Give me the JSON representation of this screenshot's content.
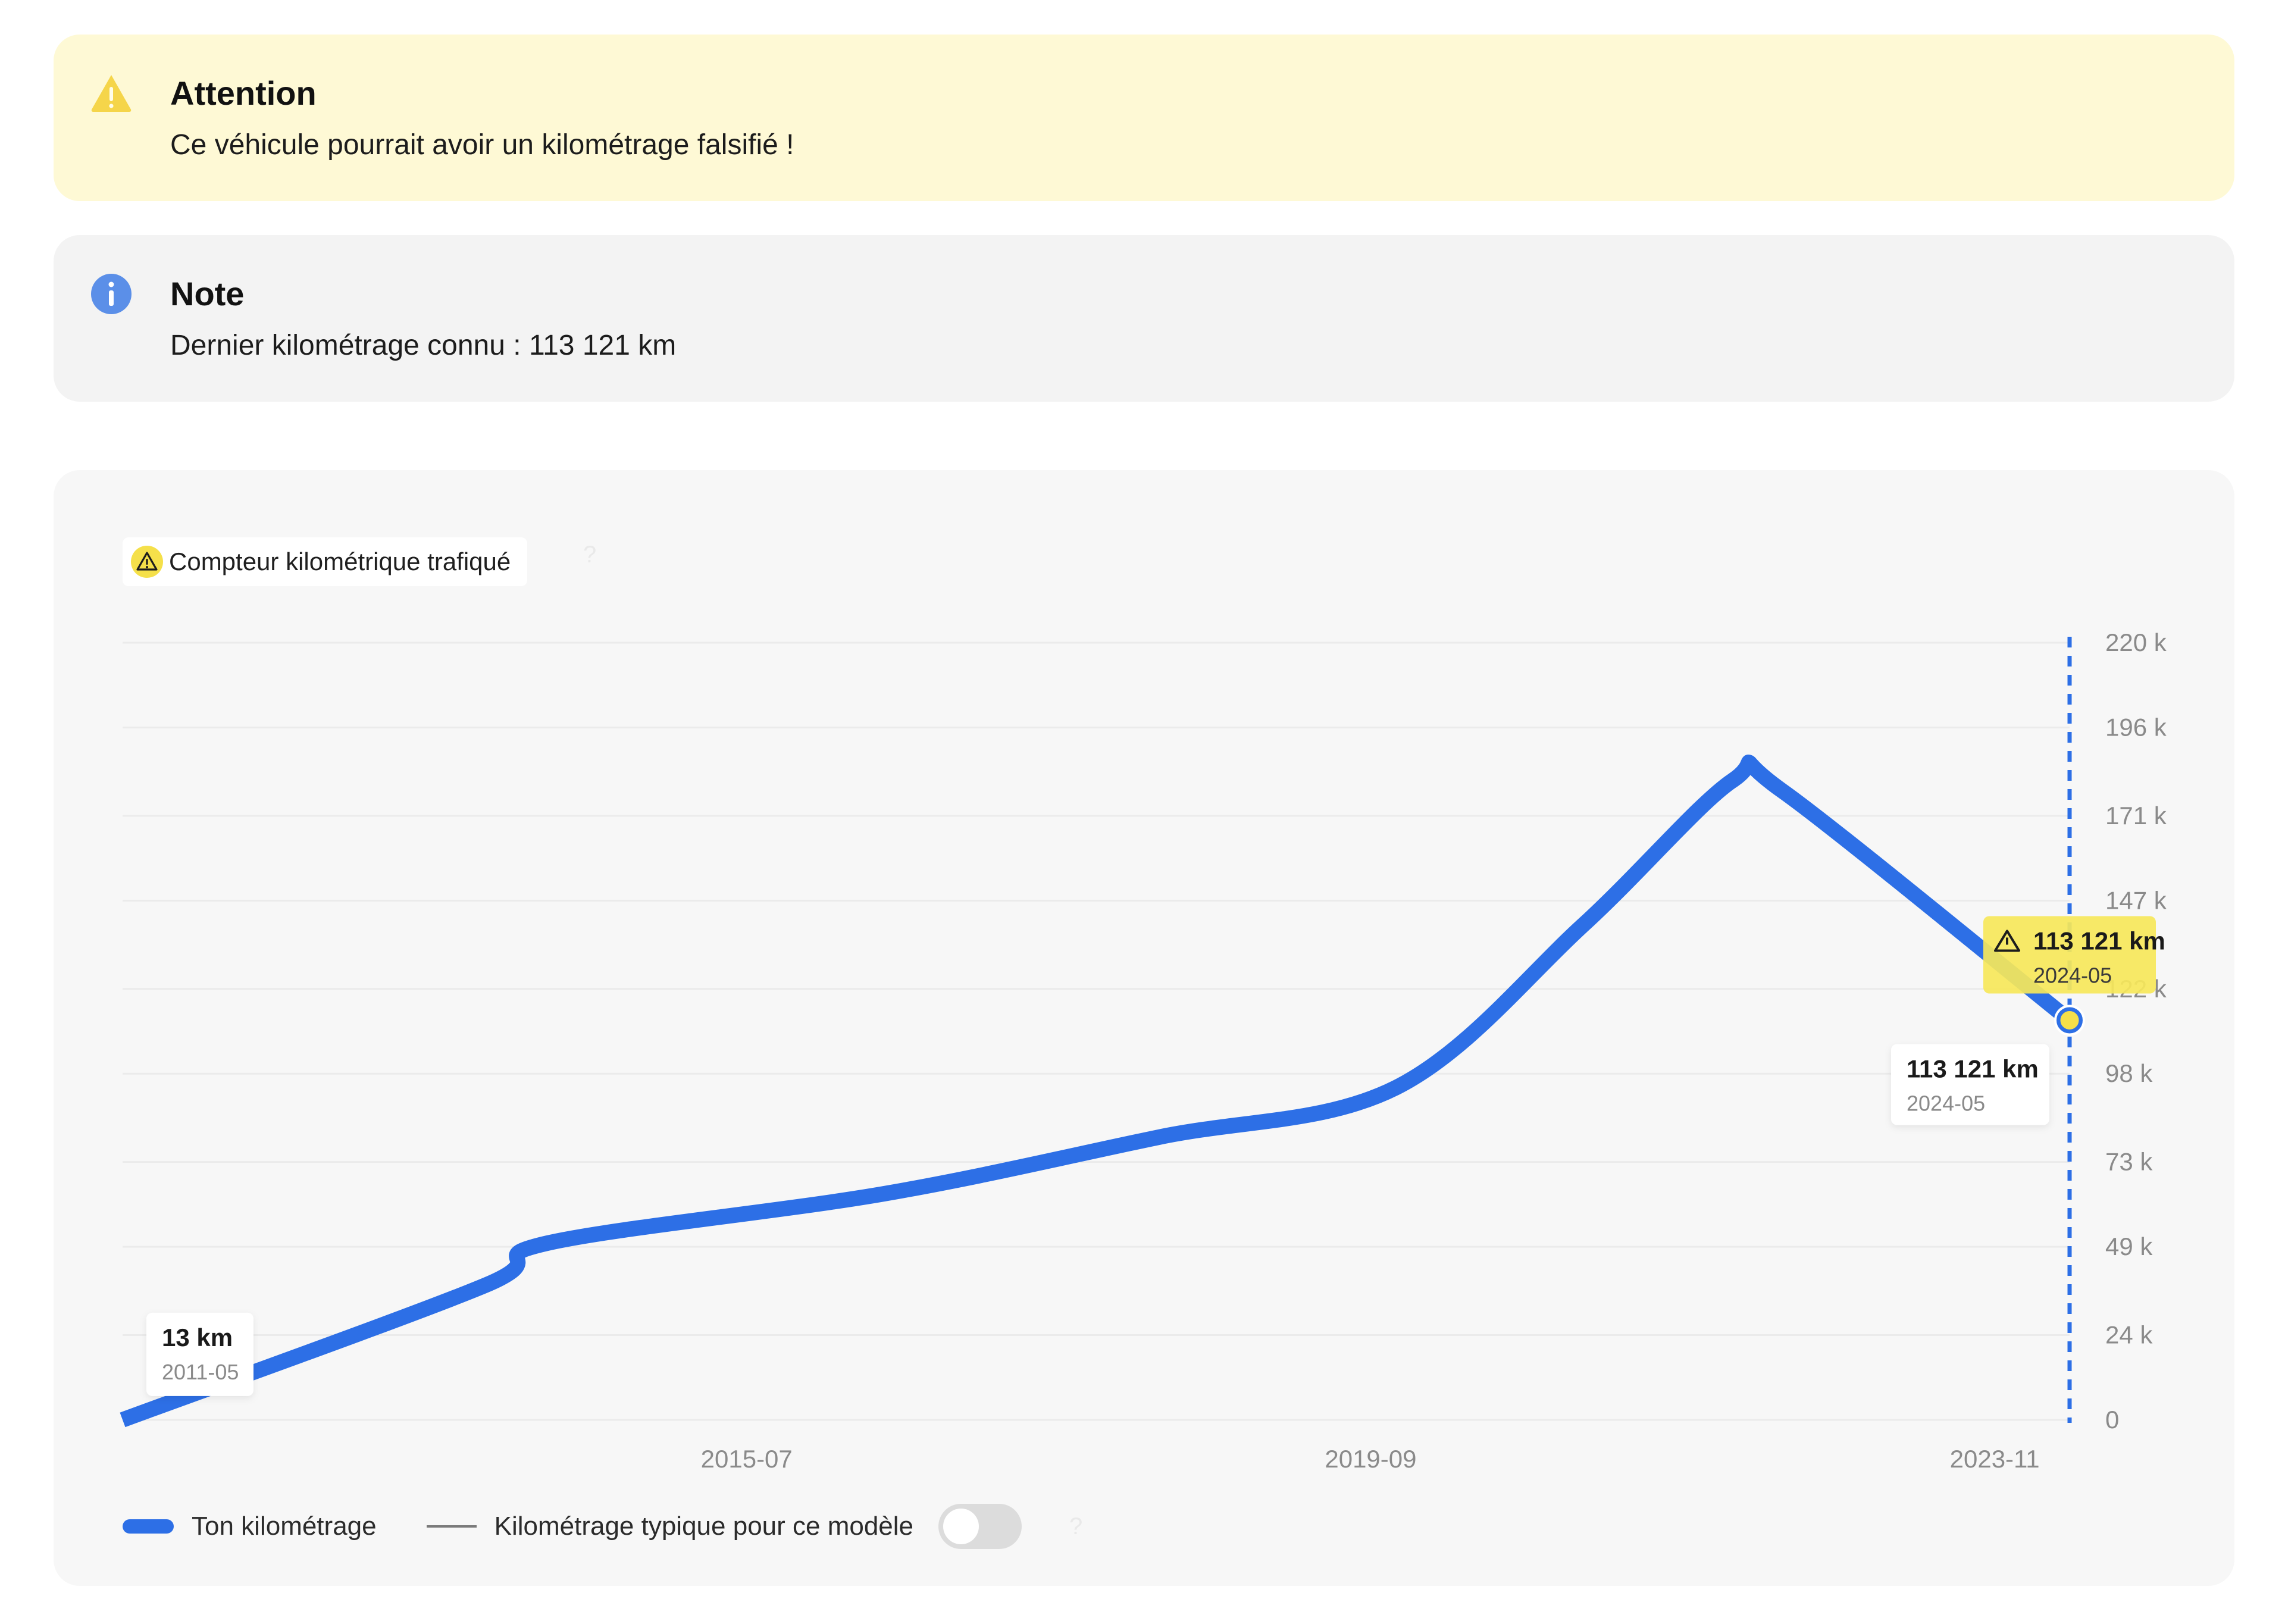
{
  "alerts": {
    "warning": {
      "title": "Attention",
      "message": "Ce véhicule pourrait avoir un kilométrage falsifié !",
      "icon": "warning-triangle-icon",
      "bg": "#fef9d5"
    },
    "note": {
      "title": "Note",
      "message": "Dernier kilométrage connu : 113 121 km",
      "icon": "info-icon",
      "bg": "#f3f3f3"
    }
  },
  "chart_card": {
    "badge_label": "Compteur kilométrique trafiqué",
    "badge_help": "?",
    "legend": {
      "series_label": "Ton kilométrage",
      "typical_label": "Kilométrage typique pour ce modèle",
      "toggle_on": false,
      "help": "?"
    }
  },
  "chart_data": {
    "type": "line",
    "y_ticks": [
      "0",
      "24 k",
      "49 k",
      "73 k",
      "98 k",
      "122 k",
      "147 k",
      "171 k",
      "196 k",
      "220 k"
    ],
    "y_tick_values": [
      0,
      24000,
      49000,
      73000,
      98000,
      122000,
      147000,
      171000,
      196000,
      220000
    ],
    "ylim": [
      0,
      220000
    ],
    "x_ticks": [
      "2015-07",
      "2019-09",
      "2023-11"
    ],
    "x_tick_values": [
      "2015-07",
      "2019-09",
      "2023-11"
    ],
    "xlim": [
      "2011-05",
      "2024-05"
    ],
    "grid": true,
    "series": [
      {
        "name": "Ton kilométrage",
        "color": "#2d6fe6",
        "points": [
          {
            "x": "2011-05",
            "y": 13
          },
          {
            "x": "2013-10",
            "y": 38000
          },
          {
            "x": "2014-03",
            "y": 50000
          },
          {
            "x": "2016-06",
            "y": 64000
          },
          {
            "x": "2018-04",
            "y": 80000
          },
          {
            "x": "2019-11",
            "y": 94000
          },
          {
            "x": "2021-02",
            "y": 140000
          },
          {
            "x": "2022-02",
            "y": 181000
          },
          {
            "x": "2022-06",
            "y": 178000
          },
          {
            "x": "2024-05",
            "y": 113121
          }
        ]
      }
    ],
    "cursor_x": "2024-05",
    "annotations": [
      {
        "label": "13 km",
        "date": "2011-05",
        "style": "plain"
      },
      {
        "label": "113 121 km",
        "date": "2024-05",
        "style": "plain"
      },
      {
        "label": "113 121 km",
        "date": "2024-05",
        "style": "warning"
      }
    ]
  }
}
